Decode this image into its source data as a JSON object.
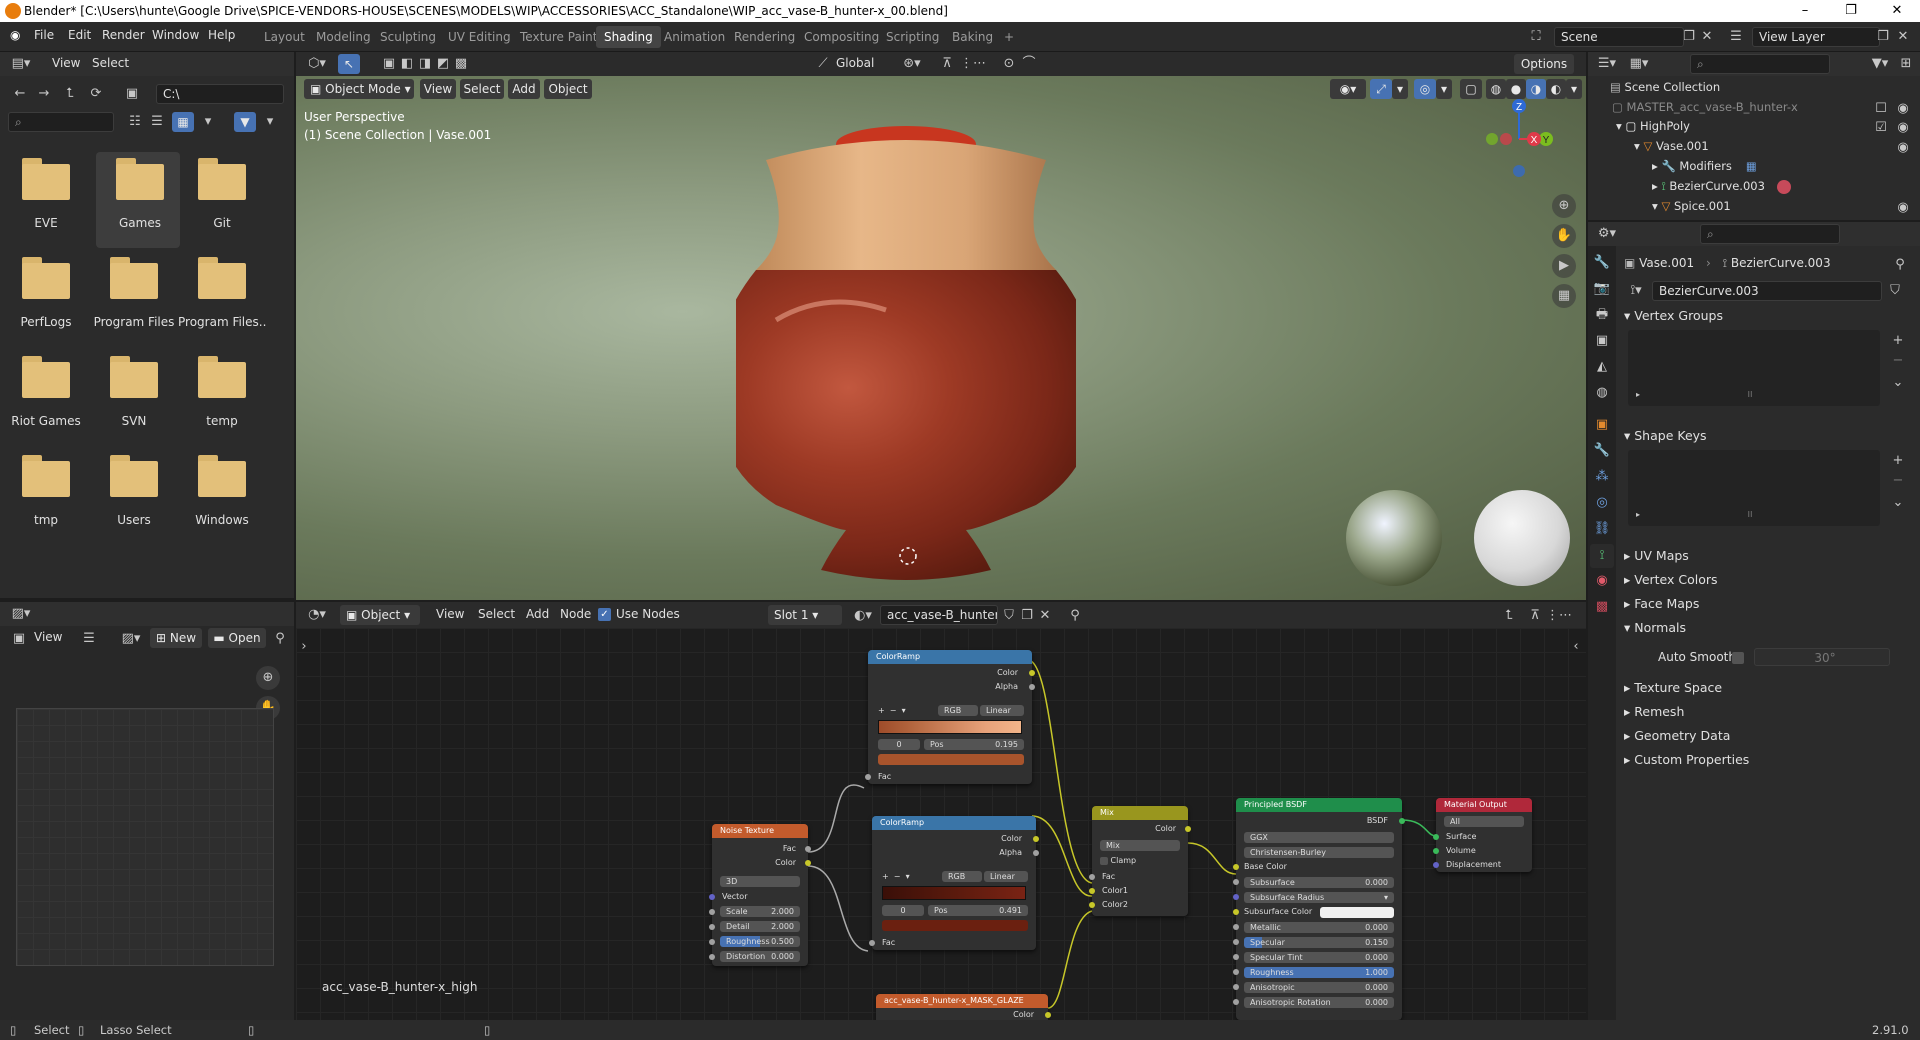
{
  "window": {
    "title": "Blender* [C:\\Users\\hunte\\Google Drive\\SPICE-VENDORS-HOUSE\\SCENES\\MODELS\\WIP\\ACCESSORIES\\ACC_Standalone\\WIP_acc_vase-B_hunter-x_00.blend]"
  },
  "menu": [
    "File",
    "Edit",
    "Render",
    "Window",
    "Help"
  ],
  "workspaces": [
    "Layout",
    "Modeling",
    "Sculpting",
    "UV Editing",
    "Texture Paint",
    "Shading",
    "Animation",
    "Rendering",
    "Compositing",
    "Scripting",
    "Baking"
  ],
  "active_workspace": "Shading",
  "top_right": {
    "scene": "Scene",
    "view_layer": "View Layer"
  },
  "file_browser": {
    "header": [
      "View",
      "Select"
    ],
    "path": "C:\\",
    "folders": [
      "EVE",
      "Games",
      "Git",
      "PerfLogs",
      "Program Files",
      "Program Files...",
      "Riot Games",
      "SVN",
      "temp",
      "tmp",
      "Users",
      "Windows"
    ],
    "selected": "Games"
  },
  "viewport": {
    "mode": "Object Mode",
    "menus": [
      "View",
      "Select",
      "Add",
      "Object"
    ],
    "transform": "Global",
    "options": "Options",
    "info_line1": "User Perspective",
    "info_line2": "(1) Scene Collection | Vase.001",
    "gizmo": {
      "x": "X",
      "y": "Y",
      "z": "Z"
    }
  },
  "image_editor": {
    "view": "View",
    "new": "New",
    "open": "Open"
  },
  "node_editor": {
    "type": "Object",
    "menus": [
      "View",
      "Select",
      "Add",
      "Node"
    ],
    "use_nodes": "Use Nodes",
    "slot": "Slot 1",
    "material": "acc_vase-B_hunter-x...",
    "object_label": "acc_vase-B_hunter-x_high",
    "nodes": {
      "colorramp1": {
        "title": "ColorRamp",
        "out1": "Color",
        "out2": "Alpha",
        "mode": "RGB",
        "interp": "Linear",
        "idx": "0",
        "pos_label": "Pos",
        "pos": "0.195",
        "in": "Fac"
      },
      "colorramp2": {
        "title": "ColorRamp",
        "out1": "Color",
        "out2": "Alpha",
        "mode": "RGB",
        "interp": "Linear",
        "idx": "0",
        "pos_label": "Pos",
        "pos": "0.491",
        "in": "Fac"
      },
      "noise": {
        "title": "Noise Texture",
        "out1": "Fac",
        "out2": "Color",
        "dim": "3D",
        "vector": "Vector",
        "rows": [
          [
            "Scale",
            "2.000"
          ],
          [
            "Detail",
            "2.000"
          ],
          [
            "Roughness",
            "0.500"
          ],
          [
            "Distortion",
            "0.000"
          ]
        ]
      },
      "mix": {
        "title": "Mix",
        "out": "Color",
        "blend": "Mix",
        "clamp": "Clamp",
        "in1": "Fac",
        "in2": "Color1",
        "in3": "Color2"
      },
      "bsdf": {
        "title": "Principled BSDF",
        "out": "BSDF",
        "dist": "GGX",
        "sss": "Christensen-Burley",
        "base": "Base Color",
        "rows": [
          [
            "Subsurface",
            "0.000"
          ],
          [
            "Subsurface Radius",
            ""
          ],
          [
            "Subsurface Color",
            ""
          ],
          [
            "Metallic",
            "0.000"
          ],
          [
            "Specular",
            "0.150"
          ],
          [
            "Specular Tint",
            "0.000"
          ],
          [
            "Roughness",
            "1.000"
          ],
          [
            "Anisotropic",
            "0.000"
          ],
          [
            "Anisotropic Rotation",
            "0.000"
          ]
        ]
      },
      "output": {
        "title": "Material Output",
        "target": "All",
        "in1": "Surface",
        "in2": "Volume",
        "in3": "Displacement"
      },
      "mask": {
        "title": "acc_vase-B_hunter-x_MASK_GLAZE",
        "out": "Color"
      }
    }
  },
  "outliner": {
    "root": "Scene Collection",
    "rows": [
      {
        "label": "MASTER_acc_vase-B_hunter-x",
        "indent": 0,
        "dim": true
      },
      {
        "label": "HighPoly",
        "indent": 1
      },
      {
        "label": "Vase.001",
        "indent": 2
      },
      {
        "label": "Modifiers",
        "indent": 3
      },
      {
        "label": "BezierCurve.003",
        "indent": 3
      },
      {
        "label": "Spice.001",
        "indent": 3
      }
    ]
  },
  "properties": {
    "crumb_object": "Vase.001",
    "crumb_data": "BezierCurve.003",
    "datablock": "BezierCurve.003",
    "sections": [
      "Vertex Groups",
      "Shape Keys",
      "UV Maps",
      "Vertex Colors",
      "Face Maps",
      "Normals",
      "Texture Space",
      "Remesh",
      "Geometry Data",
      "Custom Properties"
    ],
    "auto_smooth": "Auto Smooth",
    "angle": "30°"
  },
  "status": {
    "select": "Select",
    "lasso": "Lasso Select",
    "version": "2.91.0"
  }
}
